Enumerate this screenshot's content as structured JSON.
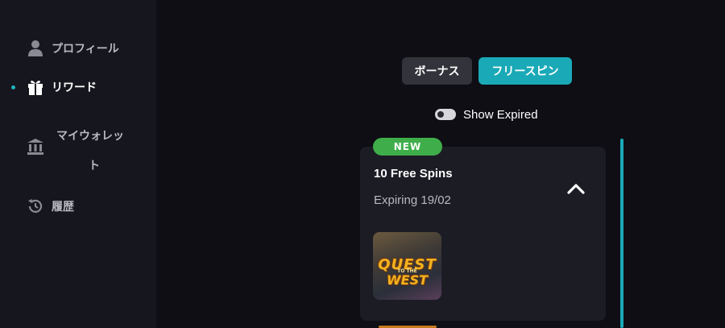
{
  "sidebar": {
    "items": [
      {
        "label": "プロフィール",
        "icon": "user-icon"
      },
      {
        "label": "リワード",
        "icon": "gift-icon"
      },
      {
        "label_line1": "マイウォレッ",
        "label_line2": "ト",
        "icon": "bank-icon"
      },
      {
        "label": "履歴",
        "icon": "history-icon"
      }
    ],
    "active_color": "#1fb4c0"
  },
  "tabs": {
    "bonus": "ボーナス",
    "freespins": "フリースピン",
    "active_color": "#1aa9b7"
  },
  "filter": {
    "show_expired_label": "Show Expired",
    "show_expired_on": false
  },
  "card": {
    "badge": "NEW",
    "title": "10 Free Spins",
    "expiry": "Expiring 19/02",
    "game": {
      "logo_line1": "QUEST",
      "logo_mid": "TO THE",
      "logo_line2": "WEST"
    },
    "badge_color": "#3fae4a"
  }
}
